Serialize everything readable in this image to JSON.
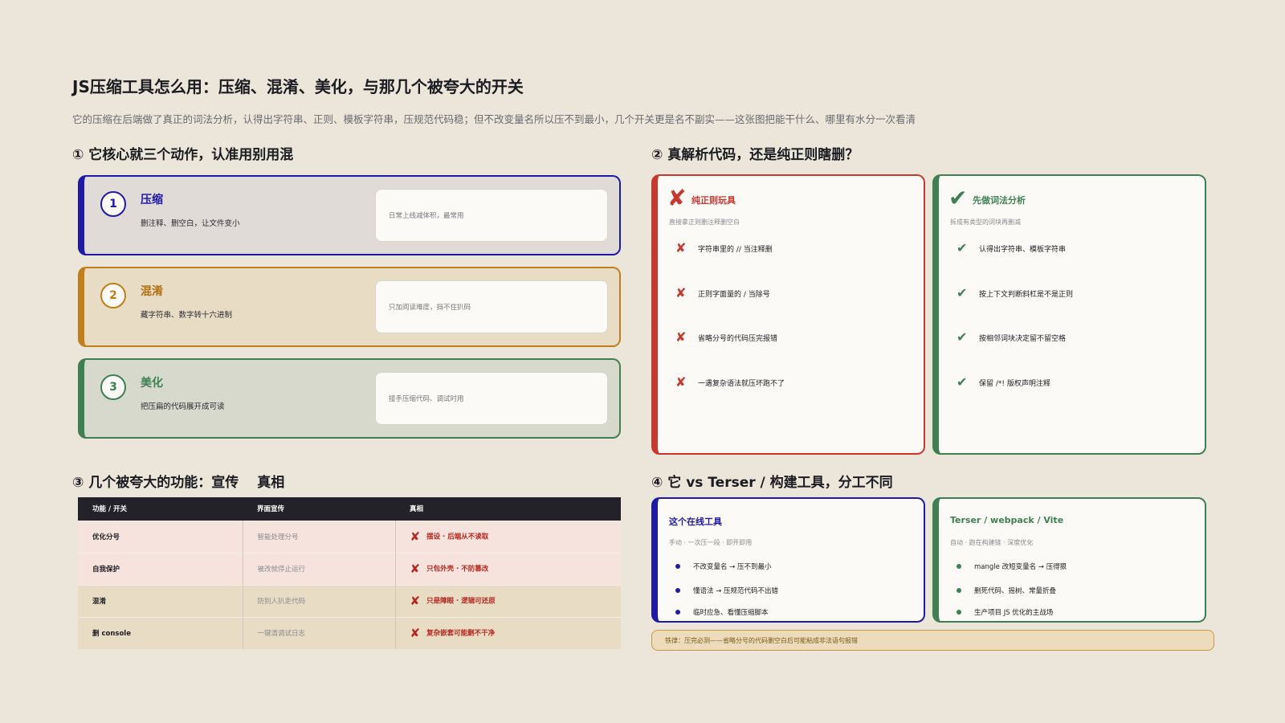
{
  "title": "JS压缩工具怎么用：压缩、混淆、美化，与那几个被夸大的开关",
  "subtitle": "它的压缩在后端做了真正的词法分析，认得出字符串、正则、模板字符串，压规范代码稳；但不改变量名所以压不到最小，几个开关更是名不副实——这张图把能干什么、哪里有水分一次看清",
  "colors": {
    "blue": "#1f1aa6",
    "orange": "#c07f1b",
    "green": "#3f8053",
    "red": "#c7392f"
  },
  "section1": {
    "heading": "① 它核心就三个动作，认准用别用混",
    "cards": [
      {
        "num": "1",
        "title": "压缩",
        "desc": "删注释、删空白，让文件变小",
        "note": "日常上线减体积，最常用"
      },
      {
        "num": "2",
        "title": "混淆",
        "desc": "藏字符串、数字转十六进制",
        "note": "只加阅读难度，挡不住扒码"
      },
      {
        "num": "3",
        "title": "美化",
        "desc": "把压扁的代码展开成可读",
        "note": "接手压缩代码、调试时用"
      }
    ]
  },
  "section2": {
    "heading": "② 真解析代码，还是纯正则瞎删？",
    "bad": {
      "icon": "cross-icon",
      "title": "纯正则玩具",
      "sub": "直接拿正则删注释删空白",
      "items": [
        "字符串里的 // 当注释删",
        "正则字面量的 / 当除号",
        "省略分号的代码压完报错",
        "一遇复杂语法就压坏跑不了"
      ]
    },
    "good": {
      "icon": "check-icon",
      "title": "先做词法分析",
      "sub": "拆成有类型的词块再删减",
      "items": [
        "认得出字符串、模板字符串",
        "按上下文判断斜杠是不是正则",
        "按相邻词块决定留不留空格",
        "保留 /*! 版权声明注释"
      ]
    }
  },
  "section3": {
    "heading": "③ 几个被夸大的功能：宣传　 真相",
    "columns": [
      "功能 / 开关",
      "界面宣传",
      "真相"
    ],
    "rows": [
      {
        "feature": "优化分号",
        "claim": "智能处理分号",
        "truth": "摆设 · 后端从不读取"
      },
      {
        "feature": "自我保护",
        "claim": "被改就停止运行",
        "truth": "只包外壳 · 不防篡改"
      },
      {
        "feature": "混淆",
        "claim": "防别人扒走代码",
        "truth": "只是障眼 · 逻辑可还原"
      },
      {
        "feature": "删 console",
        "claim": "一键清调试日志",
        "truth": "复杂嵌套可能删不干净"
      }
    ]
  },
  "section4": {
    "heading": "④ 它 vs Terser / 构建工具，分工不同",
    "left": {
      "title": "这个在线工具",
      "sub": "手动 · 一次压一段 · 即开即用",
      "items": [
        "不改变量名 → 压不到最小",
        "懂语法 → 压规范代码不出错",
        "临时应急、看懂压缩脚本"
      ]
    },
    "right": {
      "title": "Terser / webpack / Vite",
      "sub": "自动 · 跑在构建链 · 深度优化",
      "items": [
        "mangle 改短变量名 → 压得狠",
        "删死代码、摇树、常量折叠",
        "生产项目 JS 优化的主战场"
      ]
    },
    "warning": "铁律：压完必测——省略分号的代码删空白后可能粘成非法语句报错"
  }
}
